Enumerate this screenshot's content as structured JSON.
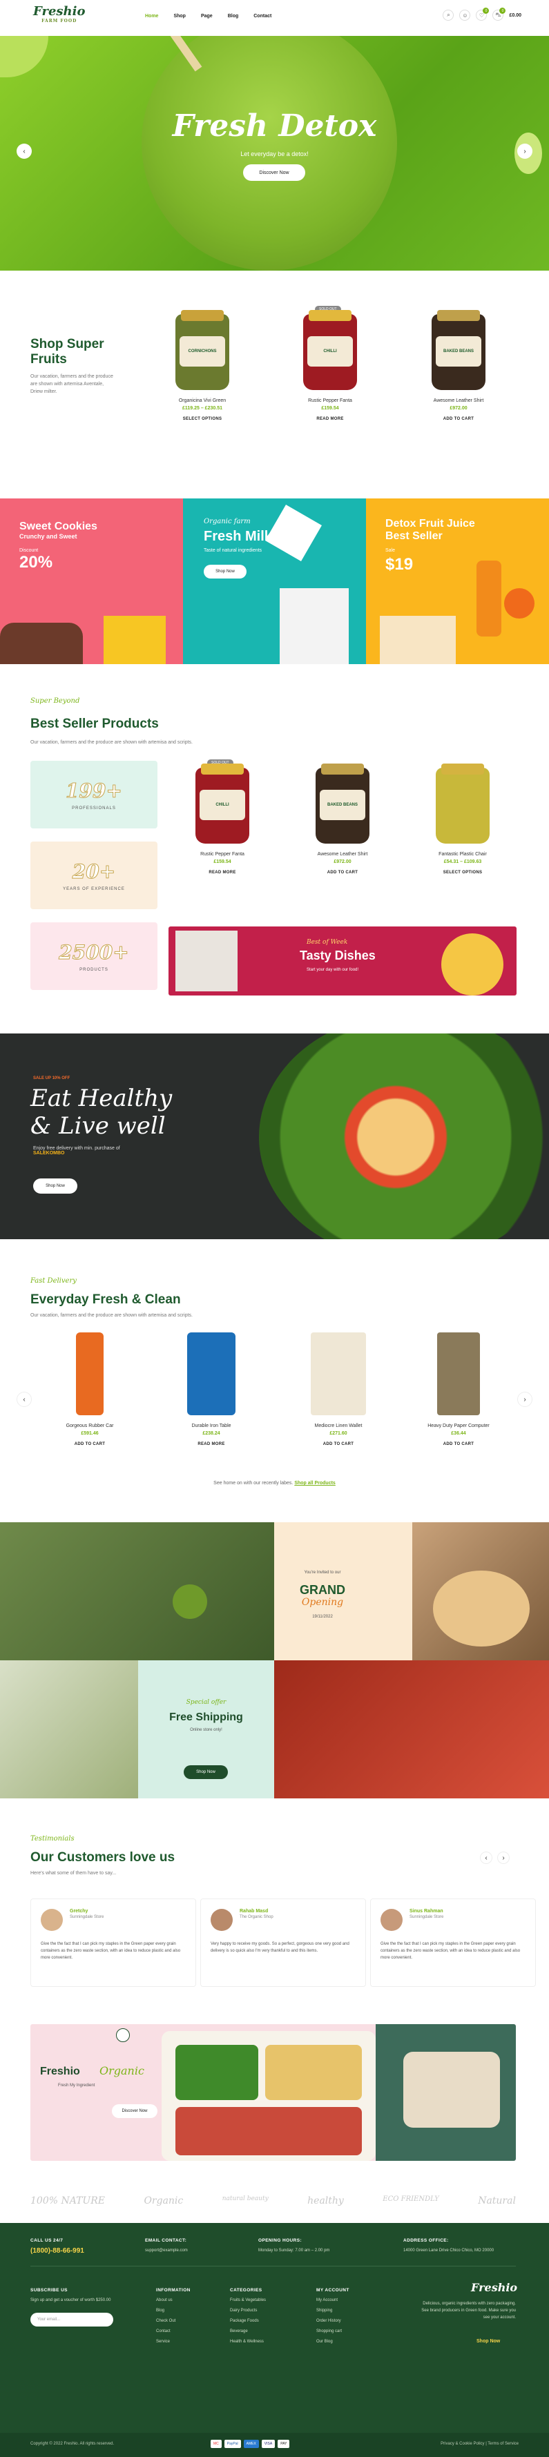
{
  "header": {
    "logo": "Freshio",
    "logo_sub": "FARM FOOD",
    "nav": [
      "Home",
      "Shop",
      "Page",
      "Blog",
      "Contact"
    ],
    "cart_total": "£0.00",
    "wishlist_count": "0",
    "cart_count": "0"
  },
  "hero": {
    "title": "Fresh Detox",
    "subtitle": "Let everyday be a detox!",
    "button": "Discover Now"
  },
  "fruits": {
    "title": "Shop Super Fruits",
    "desc": "Our vacation, farmers and the produce are shown with artemisa Aventale, Driew milter.",
    "products": [
      {
        "name": "Organicina Vivi Green",
        "price": "£119.25 – £230.51",
        "link": "SELECT OPTIONS",
        "label": "CORNICHONS"
      },
      {
        "name": "Rustic Pepper Fanta",
        "price": "£159.54",
        "link": "READ MORE",
        "label": "CHILLI"
      },
      {
        "name": "Awesome Leather Shirt",
        "price": "£972.00",
        "link": "ADD TO CART",
        "label": "BAKED BEANS"
      }
    ],
    "sale_badge": "SOLD OUT"
  },
  "promos": [
    {
      "title": "Sweet Cookies",
      "sub": "Crunchy and Sweet",
      "disc_label": "Discount",
      "value": "20%"
    },
    {
      "script": "Organic farm",
      "title": "Fresh Milk",
      "sub": "Taste of natural ingredients",
      "button": "Shop Now"
    },
    {
      "title": "Detox Fruit Juice",
      "title2": "Best Seller",
      "sale_label": "Sale",
      "value": "$19"
    }
  ],
  "best": {
    "script": "Super Beyond",
    "title": "Best Seller Products",
    "desc": "Our vacation, farmers and the produce are shown with artemisa and scripts.",
    "counters": [
      {
        "num": "199+",
        "label": "PROFESSIONALS"
      },
      {
        "num": "20+",
        "label": "YEARS OF EXPERIENCE"
      },
      {
        "num": "2500+",
        "label": "PRODUCTS"
      }
    ],
    "products": [
      {
        "name": "Rustic Pepper Fanta",
        "price": "£159.54",
        "link": "READ MORE"
      },
      {
        "name": "Awesome Leather Shirt",
        "price": "£972.00",
        "link": "ADD TO CART"
      },
      {
        "name": "Fantastic Plastic Chair",
        "price": "£54.31 – £109.63",
        "link": "SELECT OPTIONS"
      }
    ],
    "banner": {
      "script": "Best of Week",
      "title": "Tasty Dishes",
      "sub": "Start your day with our food!"
    }
  },
  "dark": {
    "badge": "SALE UP 10% OFF",
    "line1": "Eat Healthy",
    "line2": "& Live well",
    "desc": "Enjoy free delivery with min. purchase of",
    "code": "SALEKOMBO",
    "button": "Shop Now"
  },
  "everyday": {
    "script": "Fast Delivery",
    "title": "Everyday Fresh & Clean",
    "desc": "Our vacation, farmers and the produce are shown with artemisa and scripts.",
    "products": [
      {
        "name": "Gorgeous Rubber Car",
        "price": "£591.46",
        "link": "ADD TO CART"
      },
      {
        "name": "Durable Iron Table",
        "price": "£238.24",
        "link": "READ MORE"
      },
      {
        "name": "Mediocre Linen Wallet",
        "price": "£271.60",
        "link": "ADD TO CART"
      },
      {
        "name": "Heavy Duty Paper Computer",
        "price": "£36.44",
        "link": "ADD TO CART"
      }
    ],
    "more_text": "See home on with our recently labes.",
    "more_link": "Shop all Products"
  },
  "gallery": {
    "invite": "You're Invited to our",
    "grand": "GRAND",
    "opening": "Opening",
    "date": "19/11/2022",
    "ship_script": "Special offer",
    "ship_title": "Free Shipping",
    "ship_sub": "Online store only!",
    "ship_button": "Shop Now"
  },
  "reviews": {
    "script": "Testimonials",
    "title": "Our Customers love us",
    "desc": "Here's what some of them have to say...",
    "items": [
      {
        "name": "Gretchy",
        "role": "Sunningdale Store",
        "text": "Give the the fact that I can pick my staples in the Green paper every grain containers as the zero waste section, with an idea to reduce plastic and also more convenient."
      },
      {
        "name": "Rahab Masd",
        "role": "The Organic Shop",
        "text": "Very happy to receive my goods. So a perfect, gorgeous one very good and delivery is so quick also I'm very thankful to and this items."
      },
      {
        "name": "Sinus Rahman",
        "role": "Sunningdale Store",
        "text": "Give the the fact that I can pick my staples in the Green paper every grain containers as the zero waste section, with an idea to reduce plastic and also more convenient."
      }
    ]
  },
  "freshio_banner": {
    "title": "Freshio",
    "script": "Organic",
    "sub": "Fresh My Ingredient",
    "button": "Discover Now"
  },
  "brands": [
    "100% NATURE",
    "Organic",
    "natural beauty",
    "healthy",
    "ECO FRIENDLY",
    "Natural"
  ],
  "footer": {
    "call_label": "CALL US 24/7",
    "phone": "(1800)-88-66-991",
    "email_label": "EMAIL CONTACT:",
    "email": "support@example.com",
    "hours_label": "OPENING HOURS:",
    "hours": "Monday to Sunday: 7.00 am – 2.00 pm",
    "address_label": "ADDRESS OFFICE:",
    "address": "14000 Green Lane Drive Chico Chico, MO 20000",
    "subscribe_label": "SUBSCRIBE US",
    "subscribe_text": "Sign up and get a voucher of worth $250.00",
    "email_placeholder": "Your email...",
    "info_label": "INFORMATION",
    "info": [
      "About us",
      "Blog",
      "Check Out",
      "Contact",
      "Service"
    ],
    "cat_label": "CATEGORIES",
    "cats": [
      "Fruits & Vegetables",
      "Dairy Products",
      "Package Foods",
      "Beverage",
      "Health & Wellness"
    ],
    "acc_label": "MY ACCOUNT",
    "acc": [
      "My Account",
      "Shipping",
      "Order History",
      "Shopping cart",
      "Our Blog"
    ],
    "about": "Delicious, organic ingredients with zero packaging. See brand producers in Green food. Make sure you see your account.",
    "shop_now": "Shop Now",
    "copyright": "Copyright © 2022 Freshio. All rights reserved.",
    "policy": "Privacy & Cookie Policy | Terms of Service",
    "payments": [
      "MC",
      "PayPal",
      "AMEX",
      "VISA",
      "PAY"
    ]
  }
}
